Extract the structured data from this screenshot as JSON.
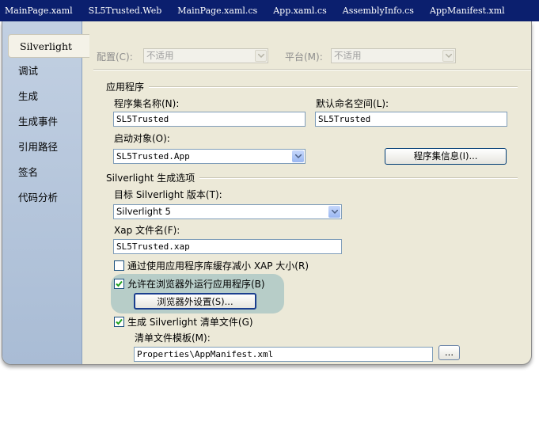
{
  "tabs": [
    "MainPage.xaml",
    "SL5Trusted.Web",
    "MainPage.xaml.cs",
    "App.xaml.cs",
    "AssemblyInfo.cs",
    "AppManifest.xml"
  ],
  "nav": {
    "items": [
      "Silverlight",
      "调试",
      "生成",
      "生成事件",
      "引用路径",
      "签名",
      "代码分析"
    ],
    "active_index": 0
  },
  "config": {
    "config_label": "配置(C):",
    "config_value": "不适用",
    "platform_label": "平台(M):",
    "platform_value": "不适用"
  },
  "application": {
    "group": "应用程序",
    "assembly_name_label": "程序集名称(N):",
    "assembly_name": "SL5Trusted",
    "default_ns_label": "默认命名空间(L):",
    "default_ns": "SL5Trusted",
    "startup_label": "启动对象(O):",
    "startup_value": "SL5Trusted.App",
    "assembly_info_button": "程序集信息(I)..."
  },
  "build": {
    "group": "Silverlight 生成选项",
    "target_label": "目标 Silverlight 版本(T):",
    "target_value": "Silverlight 5",
    "xap_label": "Xap 文件名(F):",
    "xap_value": "SL5Trusted.xap",
    "reduce_xap": "通过使用应用程序库缓存减小 XAP 大小(R)",
    "reduce_xap_checked": false,
    "oob": "允许在浏览器外运行应用程序(B)",
    "oob_checked": true,
    "oob_settings_button": "浏览器外设置(S)...",
    "gen_manifest": "生成 Silverlight 清单文件(G)",
    "gen_manifest_checked": true,
    "manifest_template_label": "清单文件模板(M):",
    "manifest_template_value": "Properties\\AppManifest.xml",
    "browse_button": "..."
  },
  "colors": {
    "tabstrip": "#0b1f6e",
    "panel": "#ece9d8",
    "highlight": "#aec8c6"
  }
}
